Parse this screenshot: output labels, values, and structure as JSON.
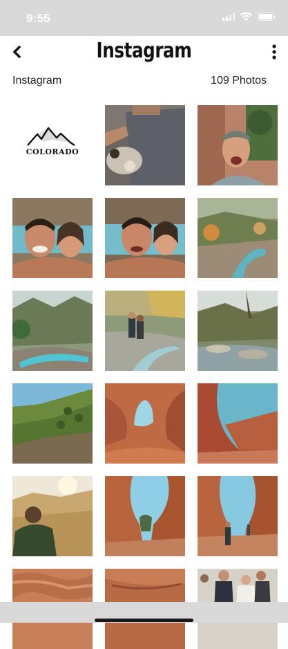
{
  "status_bar": {
    "time": "9:55"
  },
  "nav": {
    "title": "Instagram"
  },
  "album": {
    "name": "Instagram",
    "count_label": "109 Photos"
  },
  "logo_tile": {
    "brand_text": "COLORADO"
  },
  "colors": {
    "status_bar_bg": "#d9d9d9",
    "background": "#ffffff",
    "text": "#111111"
  },
  "photos": [
    {
      "subject": "colorado-logo"
    },
    {
      "subject": "cafe-table"
    },
    {
      "subject": "man-selfie-forest"
    },
    {
      "subject": "couple-selfie-hot-spring"
    },
    {
      "subject": "couple-selfie-hot-spring-2"
    },
    {
      "subject": "canyon-river-valley"
    },
    {
      "subject": "turquoise-hot-spring"
    },
    {
      "subject": "couple-hiking-river"
    },
    {
      "subject": "rocky-creek"
    },
    {
      "subject": "forested-hillside"
    },
    {
      "subject": "red-rock-arch-window"
    },
    {
      "subject": "red-rock-canyon-wall"
    },
    {
      "subject": "man-sunset-field"
    },
    {
      "subject": "slot-canyon-sky"
    },
    {
      "subject": "slot-canyon-hiker"
    },
    {
      "subject": "red-sand-texture"
    },
    {
      "subject": "red-rock-ledge"
    },
    {
      "subject": "wedding-group"
    }
  ]
}
